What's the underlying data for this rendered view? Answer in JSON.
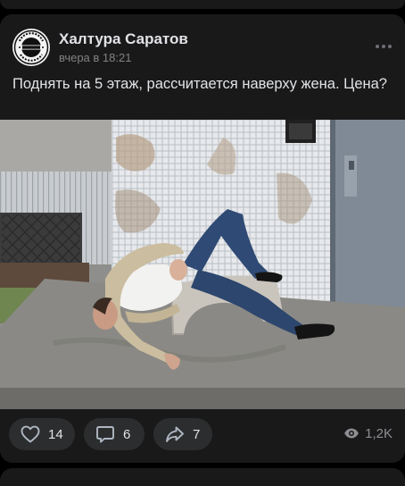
{
  "post": {
    "author": "Халтура Саратов",
    "time": "вчера в 18:21",
    "text": "Поднять на 5 этаж, рассчитается наверху жена. Цена?",
    "avatar": {
      "ring_text_top": "САРАТОВ",
      "ring_text_bottom": "ВСЕГДА",
      "center_text": "ХАЛТУРА",
      "icon": "logo-seal"
    },
    "photo": {
      "description_icon": "photo"
    }
  },
  "actions": {
    "likes": "14",
    "comments": "6",
    "shares": "7",
    "views": "1,2K"
  },
  "colors": {
    "background": "#000000",
    "card": "#19191a",
    "pill": "#2c2d2e",
    "text": "#e1e3e6",
    "muted": "#828282"
  }
}
